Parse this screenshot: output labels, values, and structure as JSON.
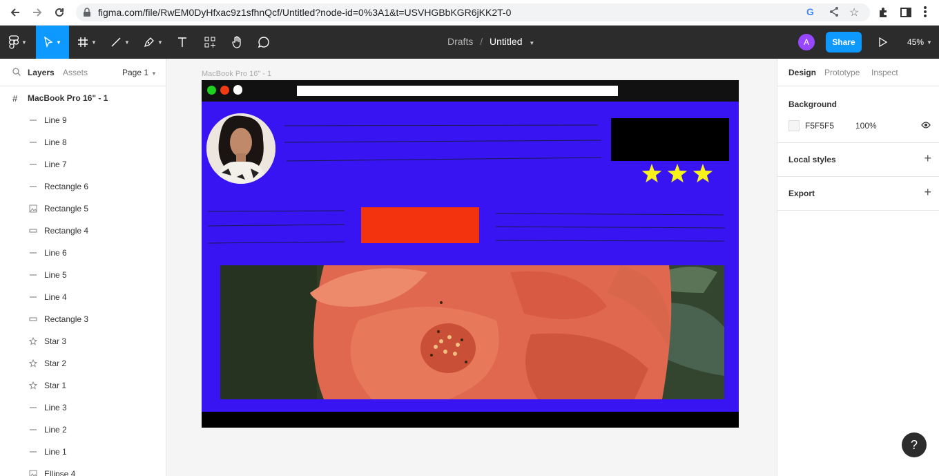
{
  "browser": {
    "url": "figma.com/file/RwEM0DyHfxac9z1sfhnQcf/Untitled?node-id=0%3A1&t=USVHGBbKGR6jKK2T-0",
    "back_icon": "arrow-left-icon",
    "forward_icon": "arrow-right-icon",
    "reload_icon": "reload-icon",
    "lock_icon": "lock-icon"
  },
  "toolbar": {
    "breadcrumb_parent": "Drafts",
    "breadcrumb_sep": "/",
    "file_name": "Untitled",
    "avatar_letter": "A",
    "share_label": "Share",
    "zoom": "45%",
    "accent": "#0d99ff"
  },
  "left_panel": {
    "tabs": [
      "Layers",
      "Assets"
    ],
    "page_selector": "Page 1",
    "frame_name": "MacBook Pro 16\" - 1",
    "layers": [
      {
        "name": "Line 9",
        "icon": "line"
      },
      {
        "name": "Line 8",
        "icon": "line"
      },
      {
        "name": "Line 7",
        "icon": "line"
      },
      {
        "name": "Rectangle 6",
        "icon": "line"
      },
      {
        "name": "Rectangle 5",
        "icon": "image"
      },
      {
        "name": "Rectangle 4",
        "icon": "rect"
      },
      {
        "name": "Line 6",
        "icon": "line"
      },
      {
        "name": "Line 5",
        "icon": "line"
      },
      {
        "name": "Line 4",
        "icon": "line"
      },
      {
        "name": "Rectangle 3",
        "icon": "rect"
      },
      {
        "name": "Star 3",
        "icon": "star"
      },
      {
        "name": "Star 2",
        "icon": "star"
      },
      {
        "name": "Star 1",
        "icon": "star"
      },
      {
        "name": "Line 3",
        "icon": "line"
      },
      {
        "name": "Line 2",
        "icon": "line"
      },
      {
        "name": "Line 1",
        "icon": "line"
      },
      {
        "name": "Ellipse 4",
        "icon": "image"
      }
    ]
  },
  "canvas": {
    "frame_label": "MacBook Pro 16\" - 1",
    "frame_color": "#3814f2",
    "traffic_light_colors": [
      "#1ed11e",
      "#f23a14",
      "#ffffff"
    ],
    "cta_color": "#f2330e",
    "star_color": "#f6f21a",
    "star_count": 3
  },
  "right_panel": {
    "tabs": [
      "Design",
      "Prototype",
      "Inspect"
    ],
    "background_title": "Background",
    "background_hex": "F5F5F5",
    "background_opacity": "100%",
    "local_styles": "Local styles",
    "export": "Export"
  },
  "help_label": "?"
}
